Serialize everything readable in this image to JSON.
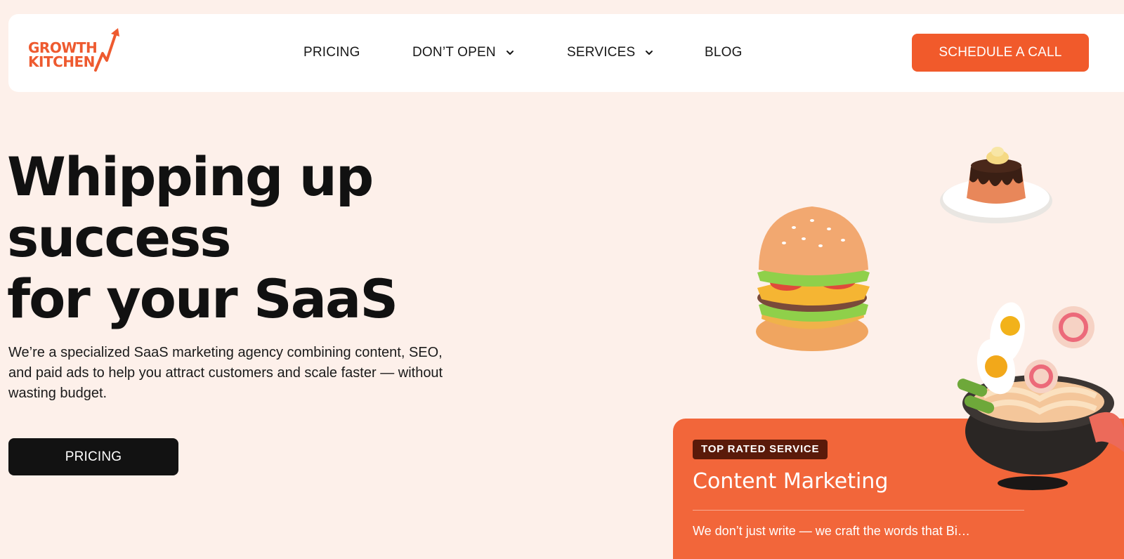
{
  "brand": {
    "logo_line_1": "GROWTH",
    "logo_line_2": "KITCHEN",
    "accent_color": "#f15a2b"
  },
  "nav": {
    "items": [
      {
        "label": "PRICING",
        "has_dropdown": false
      },
      {
        "label": "DON’T OPEN",
        "has_dropdown": true
      },
      {
        "label": "SERVICES",
        "has_dropdown": true
      },
      {
        "label": "BLOG",
        "has_dropdown": false
      }
    ],
    "cta_label": "SCHEDULE A CALL"
  },
  "hero": {
    "title_lines": [
      "Whipping up",
      "success",
      "for your SaaS"
    ],
    "description": "We’re a specialized SaaS marketing agency combining content, SEO, and paid ads to help you attract customers and scale faster — without wasting budget.",
    "button_label": "PRICING"
  },
  "card": {
    "badge": "TOP RATED SERVICE",
    "title": "Content Marketing",
    "text_partial": "We don’t just write — we craft the words that Bi…"
  },
  "images": {
    "burger": "burger-illustration",
    "pudding": "chocolate-pudding-illustration",
    "ramen": "ramen-bowl-illustration"
  },
  "colors": {
    "page_background": "#fdf0ea",
    "card_background": "#f2663a",
    "badge_background": "#5a1a0a",
    "dark_button": "#121212"
  }
}
